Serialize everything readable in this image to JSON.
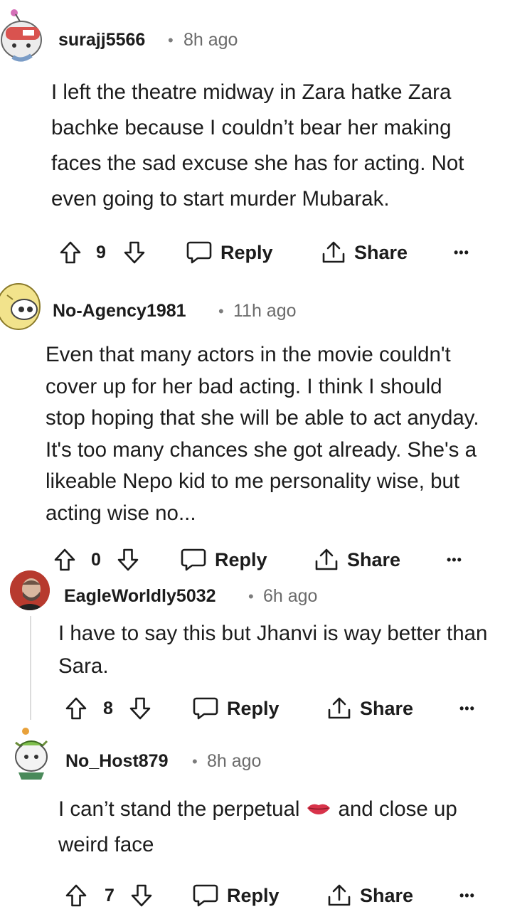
{
  "comments": [
    {
      "username": "surajj5566",
      "separator": "•",
      "time": "8h ago",
      "lines": [
        "I left the theatre midway in Zara hatke Zara",
        "bachke because I couldn’t bear her making",
        "faces the sad excuse she has for acting. Not",
        "even going to start murder Mubarak."
      ],
      "votes": "9",
      "reply_label": "Reply",
      "share_label": "Share",
      "more_label": "•••"
    },
    {
      "username": "No-Agency1981",
      "separator": "•",
      "time": "11h ago",
      "lines": [
        "Even that many actors in the movie couldn't",
        "cover up for her bad acting. I think I should",
        "stop hoping that she will be able to act anyday.",
        "It's too many chances she got already. She's a",
        "likeable Nepo kid to me personality wise, but",
        "acting wise no..."
      ],
      "votes": "0",
      "reply_label": "Reply",
      "share_label": "Share",
      "more_label": "•••"
    },
    {
      "username": "EagleWorldly5032",
      "separator": "•",
      "time": "6h ago",
      "lines": [
        "I have to say this but Jhanvi is way better than",
        "Sara."
      ],
      "votes": "8",
      "reply_label": "Reply",
      "share_label": "Share",
      "more_label": "•••"
    },
    {
      "username": "No_Host879",
      "separator": "•",
      "time": "8h ago",
      "line1_before": "I can’t stand the perpetual",
      "line1_after": "and close up",
      "line2": "weird face",
      "emoji_icon": "lips-emoji",
      "votes": "7",
      "reply_label": "Reply",
      "share_label": "Share",
      "more_label": "•••"
    }
  ],
  "colors": {
    "text": "#1c1c1c",
    "meta": "#6b6b6b",
    "thread_line": "#dcdcdc",
    "lips": "#d8334a"
  }
}
